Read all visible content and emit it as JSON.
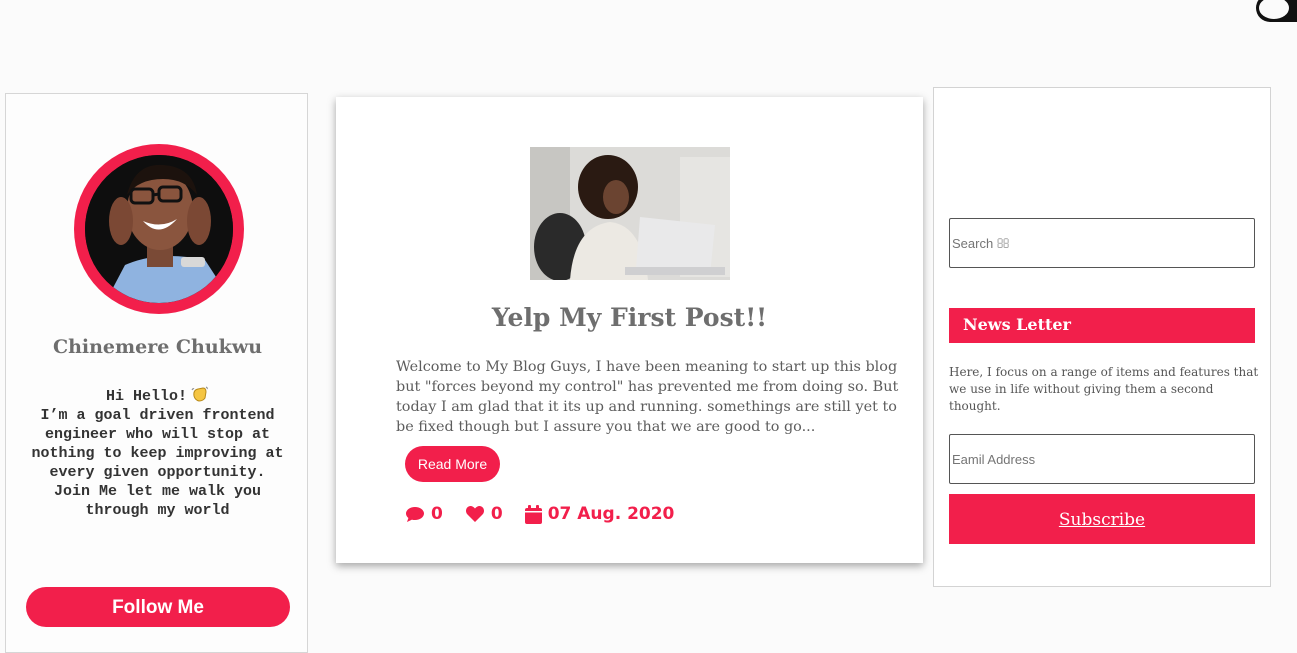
{
  "theme_toggle": {
    "state": "dark-mode-toggle"
  },
  "profile": {
    "name": "Chinemere Chukwu",
    "greeting": "Hi Hello!",
    "bio": "I’m a goal driven frontend engineer who will stop at nothing to keep improving at every given opportunity. Join Me let me walk you through my world",
    "follow_label": "Follow Me",
    "avatar_icon": "profile-photo"
  },
  "post": {
    "title": "Yelp My First Post!!",
    "excerpt": "Welcome to My Blog Guys, I have been meaning to start up this blog but \"forces beyond my control\" has prevented me from doing so. But today I am glad that it its up and running. somethings are still yet to be fixed though but I assure you that we are good to go...",
    "read_more_label": "Read More",
    "comments": "0",
    "likes": "0",
    "date": "07 Aug. 2020",
    "image_icon": "woman-at-laptop-photo"
  },
  "sidebar": {
    "search_placeholder": "Search ",
    "newsletter_title": "News Letter",
    "newsletter_text": "Here, I focus on a range of items and features that we use in life without giving them a second thought.",
    "email_placeholder": "Eamil Address",
    "subscribe_label": "Subscribe"
  },
  "colors": {
    "accent": "#f21f4b",
    "text_muted": "#6e6e6e",
    "background": "#fbfbfb"
  }
}
